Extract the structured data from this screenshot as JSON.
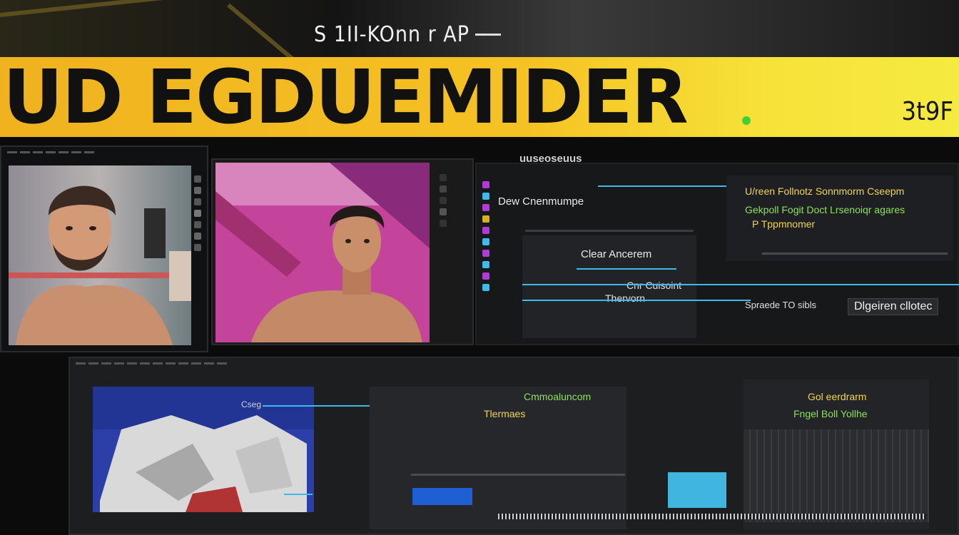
{
  "header": {
    "top_text": "S 1II-KOnn r AP",
    "banner_title": "UD EGDUEMIDER",
    "banner_code": "3t9F"
  },
  "editor_panel": {
    "title": "uuseoseuus",
    "label_main": "Dew Cnenmumpe",
    "label_clear": "Clear Ancerem",
    "label_node_a": "Cnr Cuisoint",
    "label_node_b": "Thervorn",
    "label_right_1": "U/reen Follnotz Sonnmorm Cseepm",
    "label_right_2": "Gekpoll Fogit Doct Lrsenoiqr agares",
    "label_right_3": "P Tppmnomer",
    "label_right_4": "Spraede TO sibls",
    "button_label": "Dlgeiren cllotec"
  },
  "bottom_panel": {
    "label_clip": "Cseg",
    "label_center_1": "Cmmoaluncom",
    "label_center_2": "Tlermaes",
    "label_right_1": "Gol eerdrarm",
    "label_right_2": "Fngel Boll Yollhe"
  },
  "colors": {
    "banner_yellow": "#f5c223",
    "accent_cyan": "#3fb9e8",
    "accent_green": "#43d13a",
    "accent_purple": "#b13bd8",
    "panel_bg": "#1c1d1f"
  }
}
